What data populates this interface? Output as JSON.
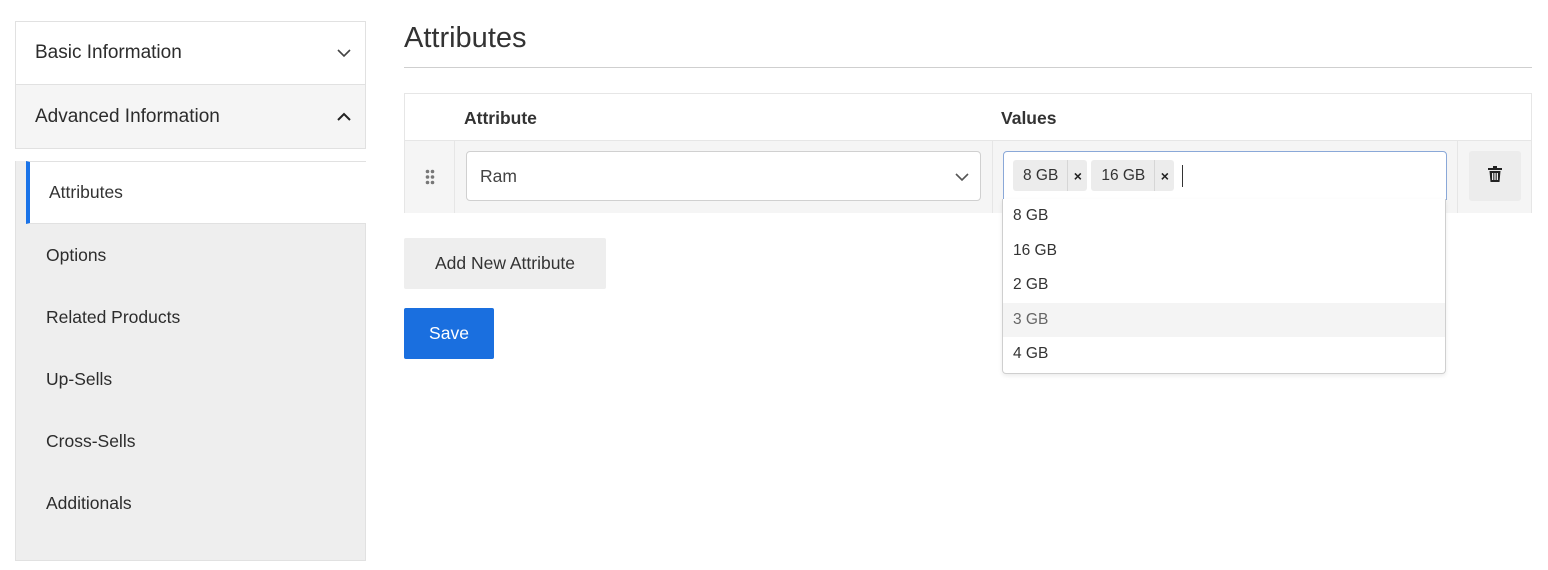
{
  "sidebar": {
    "sections": [
      {
        "label": "Basic Information",
        "expanded": false
      },
      {
        "label": "Advanced Information",
        "expanded": true
      }
    ],
    "items": [
      {
        "label": "Attributes",
        "active": true
      },
      {
        "label": "Options",
        "active": false
      },
      {
        "label": "Related Products",
        "active": false
      },
      {
        "label": "Up-Sells",
        "active": false
      },
      {
        "label": "Cross-Sells",
        "active": false
      },
      {
        "label": "Additionals",
        "active": false
      }
    ]
  },
  "main": {
    "title": "Attributes",
    "table": {
      "headers": {
        "attribute": "Attribute",
        "values": "Values"
      },
      "rows": [
        {
          "attribute": "Ram",
          "values": [
            "8 GB",
            "16 GB"
          ]
        }
      ]
    },
    "dropdown": {
      "options": [
        "8 GB",
        "16 GB",
        "2 GB",
        "3 GB",
        "4 GB"
      ],
      "highlighted": "3 GB"
    },
    "add_button_label": "Add New Attribute",
    "save_button_label": "Save"
  },
  "colors": {
    "accent": "#1a73e8",
    "save_button": "#1a6fdf",
    "sidebar_bg": "#eeeeee"
  },
  "icons": {
    "chevron_down": "chevron-down-icon",
    "chevron_up": "chevron-up-icon",
    "drag": "drag-handle-icon",
    "trash": "trash-icon",
    "remove_tag": "close-icon"
  }
}
